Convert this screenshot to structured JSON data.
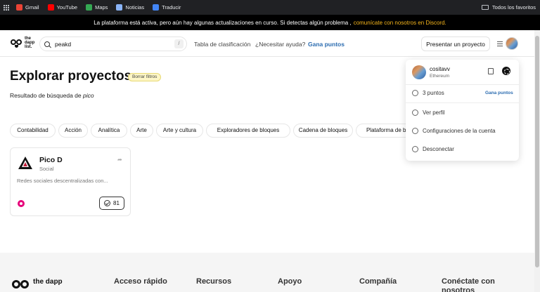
{
  "bookmarks": {
    "items": [
      {
        "label": "Gmail",
        "color": "#ea4335"
      },
      {
        "label": "YouTube",
        "color": "#ff0000"
      },
      {
        "label": "Maps",
        "color": "#34a853"
      },
      {
        "label": "Noticias",
        "color": "#8ab4f8"
      },
      {
        "label": "Traducir",
        "color": "#4285f4"
      }
    ],
    "all_favorites": "Todos los favoritos"
  },
  "announcement": {
    "text": "La plataforma está activa, pero aún hay algunas actualizaciones en curso. Si detectas algún problema ,",
    "link": "comunícate con nosotros en Discord."
  },
  "header": {
    "logo_text": "the dapp list.",
    "search_value": "peakd",
    "search_shortcut": "/",
    "nav": [
      "Tabla de clasificación",
      "¿Necesitar ayuda?"
    ],
    "points_link": "Gana puntos",
    "present_button": "Presentar un proyecto"
  },
  "main": {
    "title": "Explorar proyectos",
    "clear_filters": "Borrar filtros",
    "result_prefix": "Resultado de búsqueda de",
    "result_term": "pico",
    "categories": [
      "Contabilidad",
      "Acción",
      "Analítica",
      "Arte",
      "Arte y cultura",
      "Exploradores de bloques",
      "Cadena de bloques",
      "Plataforma de bloques"
    ]
  },
  "card": {
    "name": "Pico D",
    "category": "Social",
    "description": "Redes sociales descentralizadas con...",
    "votes": "81"
  },
  "dropdown": {
    "username": "cositavv",
    "network": "Ethereum",
    "points": "3 puntos",
    "points_link": "Gana puntos",
    "menu": [
      "Ver perfil",
      "Configuraciones de la cuenta",
      "Desconectar"
    ]
  },
  "footer": {
    "logo_text": "the dapp",
    "columns": [
      "Acceso rápido",
      "Recursos",
      "Apoyo",
      "Compañía",
      "Conéctate con nosotros"
    ]
  }
}
